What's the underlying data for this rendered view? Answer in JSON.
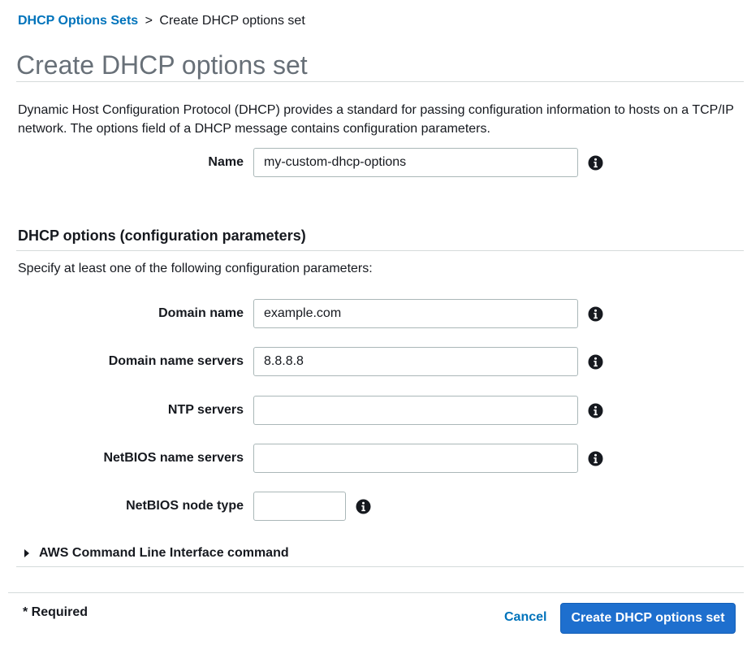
{
  "breadcrumb": {
    "parent": "DHCP Options Sets",
    "separator": ">",
    "current": "Create DHCP options set"
  },
  "page_title": "Create DHCP options set",
  "description": "Dynamic Host Configuration Protocol (DHCP) provides a standard for passing configuration information to hosts on a TCP/IP network. The options field of a DHCP message contains configuration parameters.",
  "name_field": {
    "label": "Name",
    "value": "my-custom-dhcp-options"
  },
  "options_section": {
    "heading": "DHCP options (configuration parameters)",
    "description": "Specify at least one of the following configuration parameters:",
    "fields": {
      "domain_name": {
        "label": "Domain name",
        "value": "example.com"
      },
      "domain_name_servers": {
        "label": "Domain name servers",
        "value": "8.8.8.8"
      },
      "ntp_servers": {
        "label": "NTP servers",
        "value": ""
      },
      "netbios_name_servers": {
        "label": "NetBIOS name servers",
        "value": ""
      },
      "netbios_node_type": {
        "label": "NetBIOS node type",
        "value": ""
      }
    }
  },
  "cli_expander": {
    "label": "AWS Command Line Interface command"
  },
  "footer": {
    "required_note": "* Required",
    "cancel_label": "Cancel",
    "submit_label": "Create DHCP options set"
  },
  "colors": {
    "link": "#0073bb",
    "primary_button": "#1e6fce",
    "title_gray": "#687078",
    "divider": "#d5dbdb"
  },
  "icons": {
    "info": "info-circle-icon",
    "expander": "caret-right-icon"
  }
}
